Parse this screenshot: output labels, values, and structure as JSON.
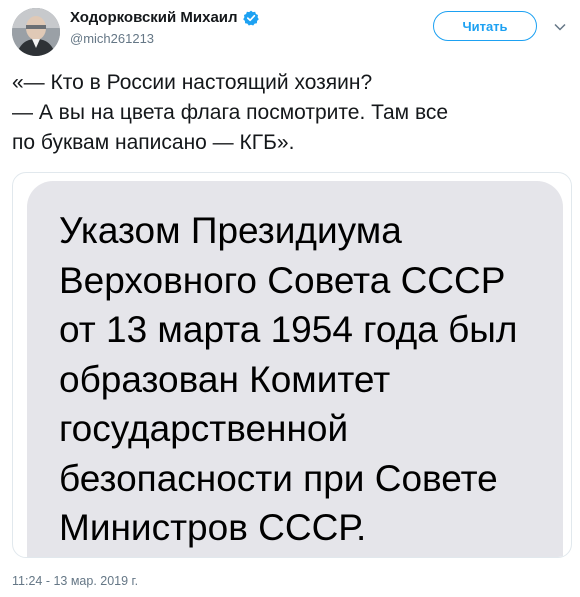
{
  "tweet": {
    "author_name": "Ходорковский Михаил",
    "author_handle": "@mich261213",
    "verified": true,
    "follow_button_label": "Читать",
    "text_lines": [
      "«— Кто в России настоящий хозяин?",
      "— А вы на цвета флага посмотрите. Там все",
      "по буквам написано — КГБ»."
    ],
    "timestamp": "11:24 - 13 мар. 2019 г."
  },
  "media": {
    "bubble_lines": [
      "Указом Президиума",
      "Верховного Совета СССР",
      "от 13 марта 1954 года был",
      "образован Комитет",
      "государственной",
      "безопасности при Совете",
      "Министров СССР."
    ]
  },
  "icons": {
    "avatar": "avatar",
    "verified": "verified-badge-icon",
    "more": "chevron-down-icon"
  },
  "colors": {
    "accent": "#1da1f2",
    "secondary_text": "#657786",
    "bubble_bg": "#e5e5ea"
  }
}
